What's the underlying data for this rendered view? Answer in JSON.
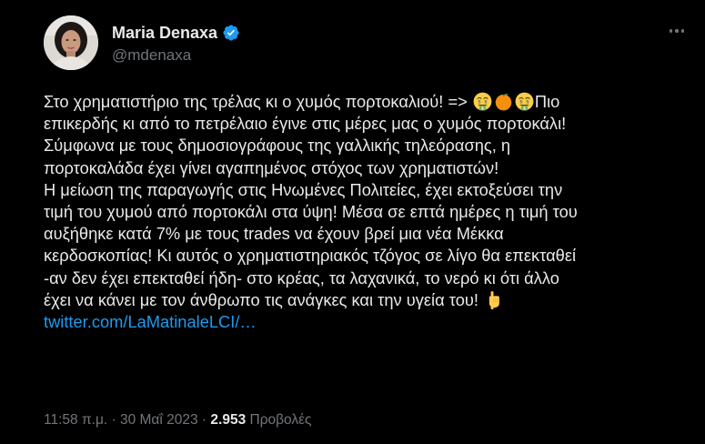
{
  "author": {
    "display_name": "Maria Denaxa",
    "handle": "@mdenaxa",
    "verified": true
  },
  "tweet": {
    "lines": [
      {
        "text": "Στο χρηματιστήριο της τρέλας κι ο χυμός πορτοκαλιού! => ",
        "suffix": "Πιο"
      },
      {
        "text": "επικερδής κι από το πετρέλαιο έγινε στις μέρες μας ο χυμός πορτοκάλι!"
      },
      {
        "text": "Σύμφωνα με τους δημοσιογράφους της γαλλικής τηλεόρασης, η"
      },
      {
        "text": "πορτοκαλάδα έχει γίνει αγαπημένος στόχος των χρηματιστών!"
      },
      {
        "text": "Η μείωση της παραγωγής στις Ηνωμένες Πολιτείες, έχει εκτοξεύσει την"
      },
      {
        "text": "τιμή του χυμού από πορτοκάλι στα ύψη! Μέσα σε επτά ημέρες η τιμή του"
      },
      {
        "text": "αυξήθηκε κατά 7% με τους trades να έχουν βρεί μια νέα Μέκκα"
      },
      {
        "text": "κερδοσκοπίας! Κι αυτός ο χρηματιστηριακός τζόγος σε λίγο θα επεκταθεί"
      },
      {
        "text": "-αν δεν έχει επεκταθεί ήδη- στο κρέας, τα λαχανικά, το νερό κι ότι άλλο"
      },
      {
        "text": "έχει να κάνει με τον άνθρωπο τις ανάγκες και την υγεία του! "
      }
    ],
    "link_text": "twitter.com/LaMatinaleLCI/…",
    "emojis": [
      "money-mouth-face",
      "tangerine",
      "money-mouth-face",
      "backhand-index-pointing-down"
    ]
  },
  "meta": {
    "time": "11:58 π.μ.",
    "separator": " · ",
    "date": "30 Μαΐ 2023",
    "views_count": "2.953",
    "views_label": " Προβολές"
  },
  "colors": {
    "background": "#000000",
    "text": "#e7e9ea",
    "secondary": "#71767b",
    "link": "#1d9bf0",
    "verified": "#1d9bf0"
  }
}
